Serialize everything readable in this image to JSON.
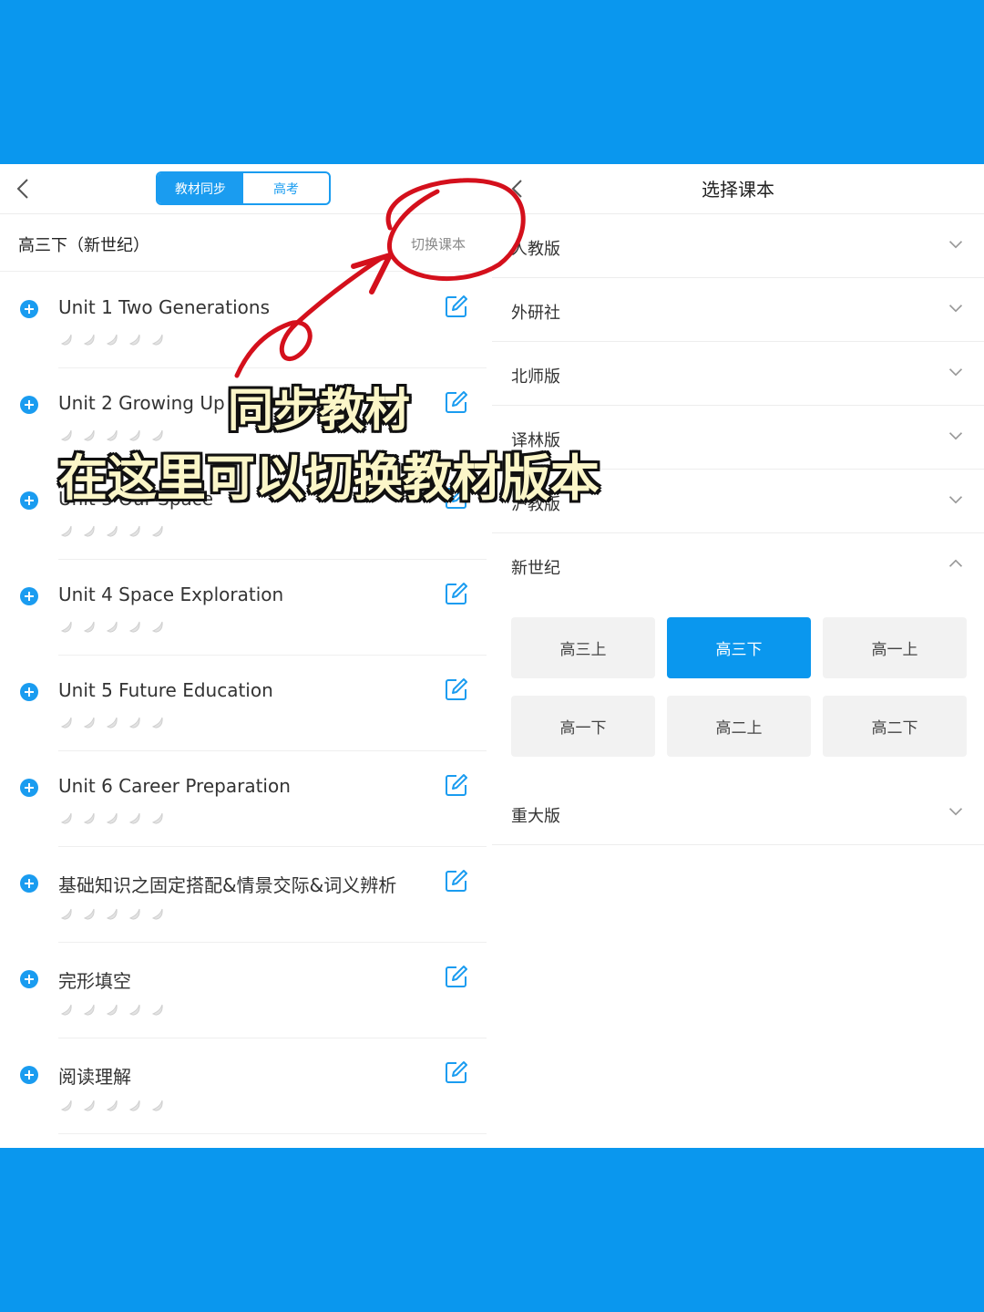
{
  "colors": {
    "accent": "#0a97ee",
    "annotation": "#d4101c"
  },
  "left_panel": {
    "tabs": [
      {
        "label": "教材同步",
        "active": true
      },
      {
        "label": "高考",
        "active": false
      }
    ],
    "current_book": "高三下（新世纪）",
    "switch_link": "切换课本",
    "units": [
      {
        "name": "Unit 1 Two Generations",
        "stars": 5
      },
      {
        "name": "Unit 2 Growing Up",
        "stars": 5
      },
      {
        "name": "Unit 3 Our Space",
        "stars": 5
      },
      {
        "name": "Unit 4 Space Exploration",
        "stars": 5
      },
      {
        "name": "Unit 5 Future Education",
        "stars": 5
      },
      {
        "name": "Unit 6 Career Preparation",
        "stars": 5
      },
      {
        "name": "基础知识之固定搭配&情景交际&词义辨析",
        "stars": 5
      },
      {
        "name": "完形填空",
        "stars": 5
      },
      {
        "name": "阅读理解",
        "stars": 5
      }
    ]
  },
  "right_panel": {
    "title": "选择课本",
    "publishers": [
      {
        "name": "人教版",
        "expanded": false
      },
      {
        "name": "外研社",
        "expanded": false
      },
      {
        "name": "北师版",
        "expanded": false
      },
      {
        "name": "译林版",
        "expanded": false
      },
      {
        "name": "沪教版",
        "expanded": false
      },
      {
        "name": "新世纪",
        "expanded": true
      },
      {
        "name": "重大版",
        "expanded": false
      }
    ],
    "grades": [
      {
        "label": "高三上",
        "selected": false
      },
      {
        "label": "高三下",
        "selected": true
      },
      {
        "label": "高一上",
        "selected": false
      },
      {
        "label": "高一下",
        "selected": false
      },
      {
        "label": "高二上",
        "selected": false
      },
      {
        "label": "高二下",
        "selected": false
      }
    ]
  },
  "annotation": {
    "line1": "同步教材",
    "line2": "在这里可以切换教材版本"
  }
}
